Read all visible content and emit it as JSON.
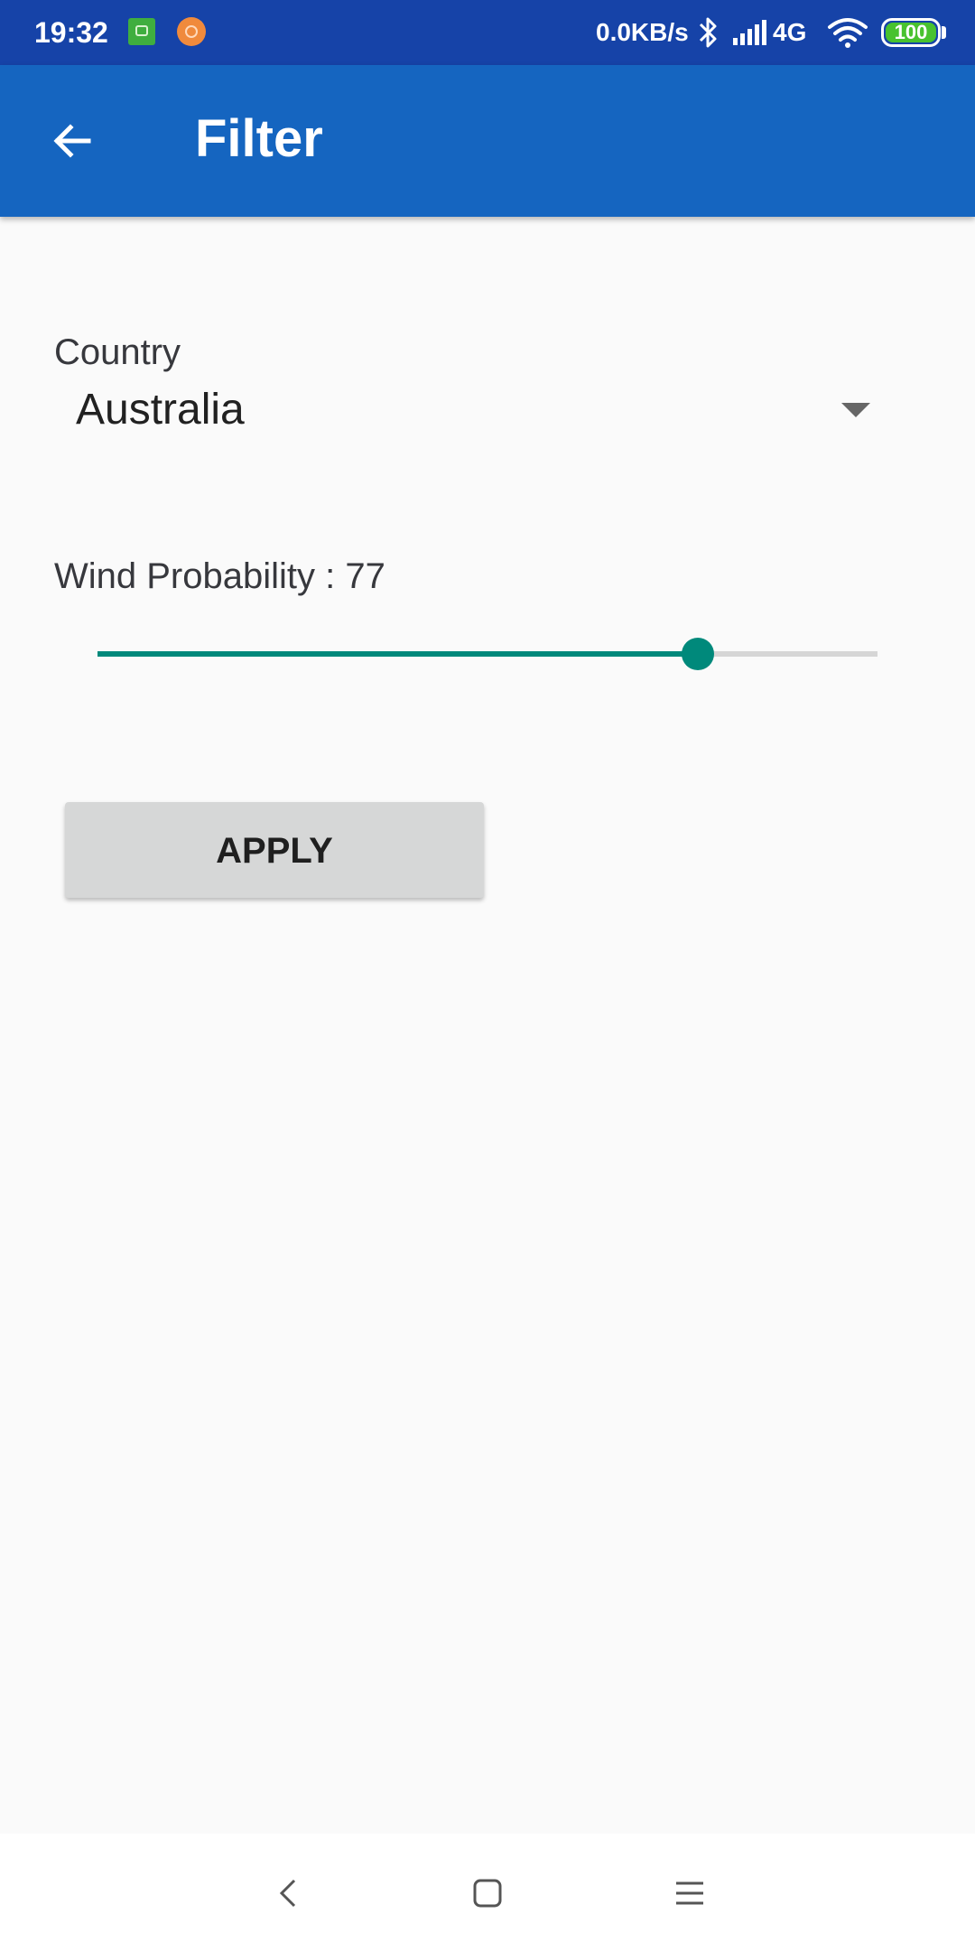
{
  "status_bar": {
    "time": "19:32",
    "net_speed": "0.0KB/s",
    "network": "4G",
    "battery": "100",
    "icons": [
      "app-notification-icon",
      "app-notification-icon",
      "bluetooth-icon",
      "signal-icon",
      "wifi-icon",
      "battery-icon"
    ]
  },
  "app_bar": {
    "title": "Filter",
    "back_icon": "arrow-back-icon",
    "color": "#1565c0"
  },
  "filter": {
    "country_label": "Country",
    "country_value": "Australia",
    "wind_label": "Wind Probability : 77",
    "wind_probability": 77,
    "wind_max": 100,
    "accent_color": "#00897b",
    "apply_label": "APPLY"
  },
  "nav_bar": {
    "icons": [
      "nav-back-icon",
      "nav-home-icon",
      "nav-menu-icon"
    ]
  }
}
